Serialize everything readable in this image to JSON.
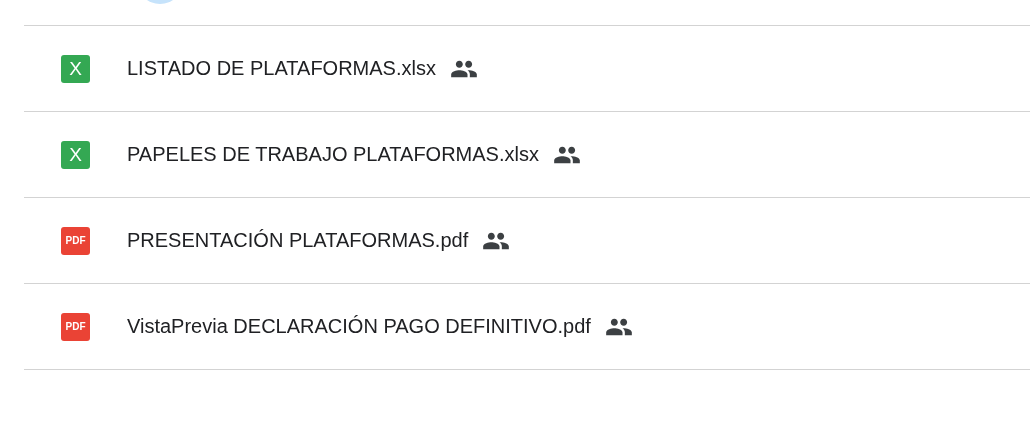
{
  "files": [
    {
      "name": "LISTADO DE PLATAFORMAS.xlsx",
      "kind": "sheet",
      "icon_text": "X",
      "shared": true
    },
    {
      "name": "PAPELES DE TRABAJO PLATAFORMAS.xlsx",
      "kind": "sheet",
      "icon_text": "X",
      "shared": true
    },
    {
      "name": "PRESENTACIÓN PLATAFORMAS.pdf",
      "kind": "pdf",
      "icon_text": "PDF",
      "shared": true
    },
    {
      "name": "VistaPrevia DECLARACIÓN PAGO DEFINITIVO.pdf",
      "kind": "pdf",
      "icon_text": "PDF",
      "shared": true
    }
  ]
}
